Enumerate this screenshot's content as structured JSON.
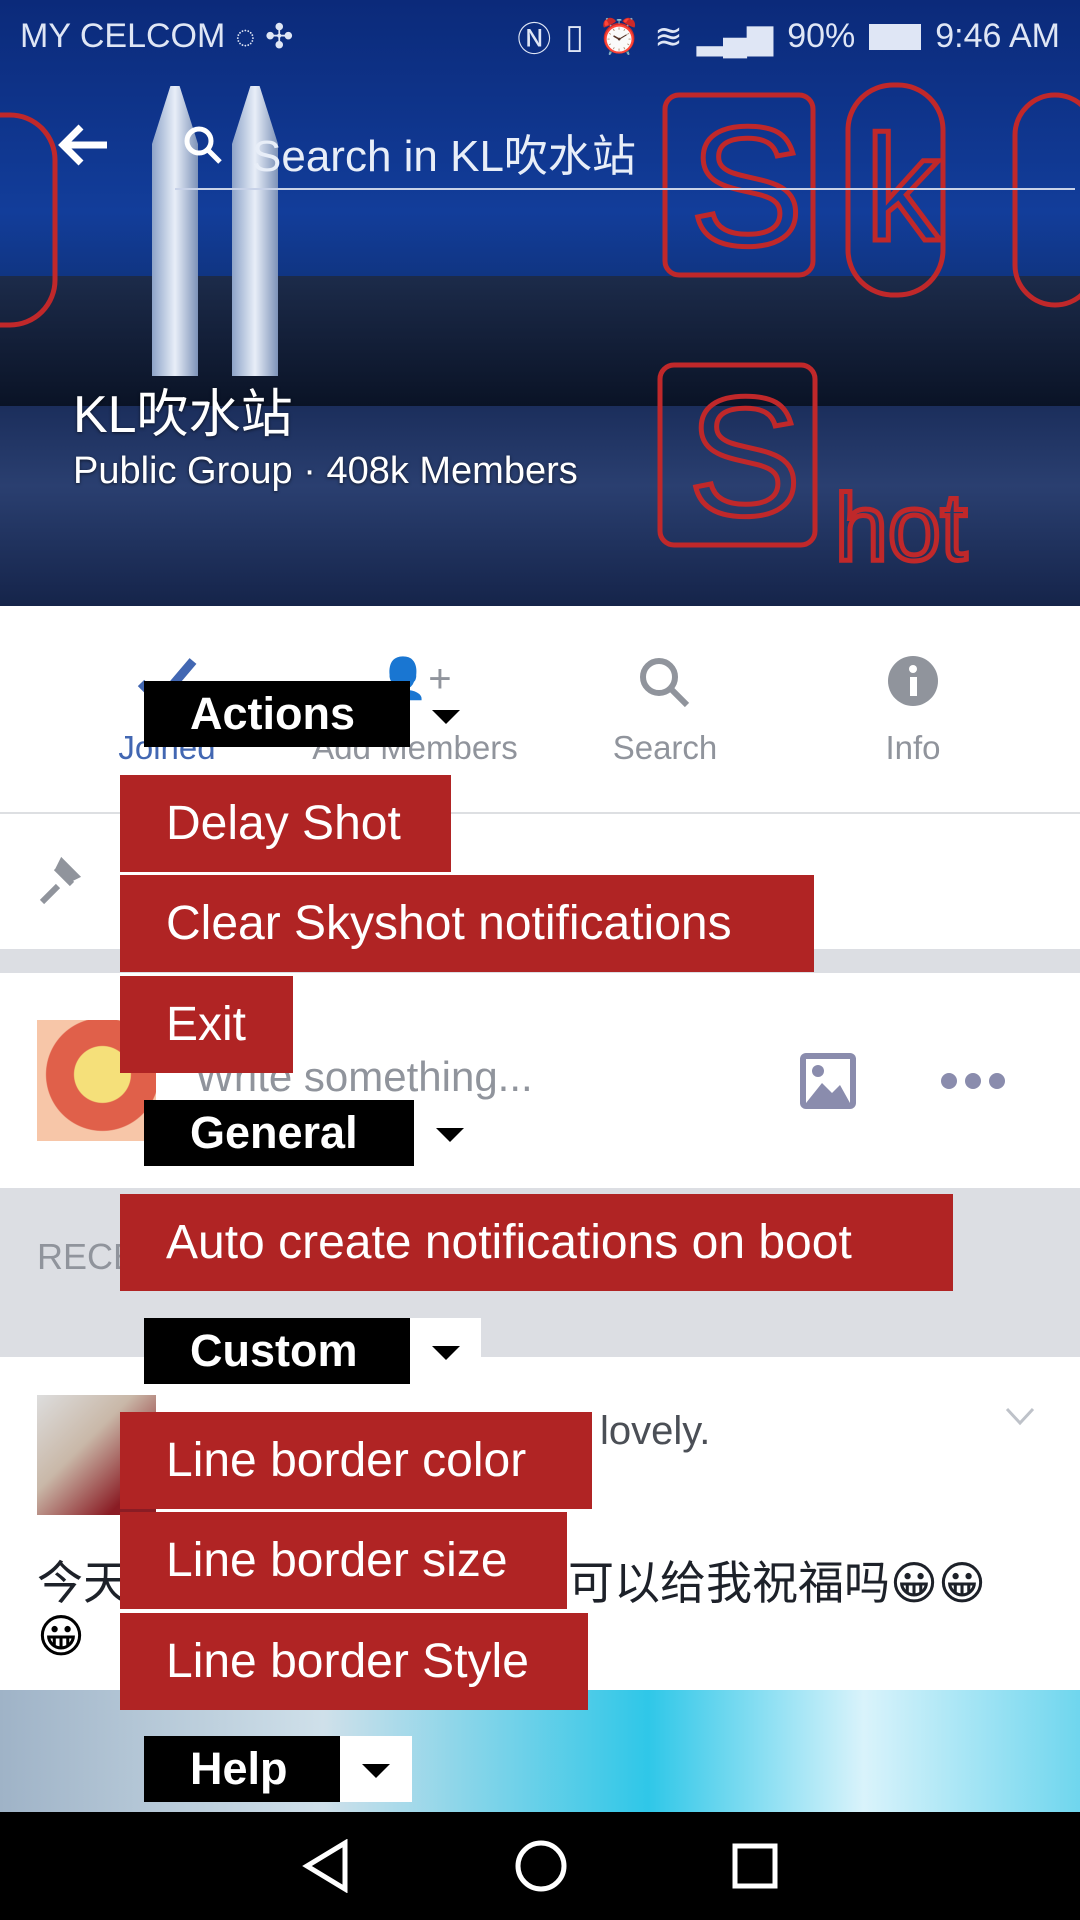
{
  "status_bar": {
    "carrier": "MY CELCOM",
    "battery": "90%",
    "time": "9:46 AM",
    "icons": [
      "whatsapp-icon",
      "pinwheel-icon",
      "nfc-icon",
      "vibrate-icon",
      "alarm-icon",
      "wifi-icon",
      "signal-icon",
      "battery-icon"
    ]
  },
  "header": {
    "search_placeholder": "Search in KL吹水站",
    "group_name": "KL吹水站",
    "group_meta": "Public Group · 408k Members"
  },
  "watermark": {
    "text": "SkyShot"
  },
  "tabs": [
    {
      "label": "Joined",
      "icon": "check-icon",
      "active": true
    },
    {
      "label": "Add Members",
      "icon": "add-person-icon"
    },
    {
      "label": "Search",
      "icon": "search-icon"
    },
    {
      "label": "Info",
      "icon": "info-icon"
    }
  ],
  "composer": {
    "placeholder": "Write something..."
  },
  "recent": {
    "label": "RECE"
  },
  "post": {
    "header_fragment": "lovely.",
    "text": "今天",
    "text_tail": "可以给我祝福吗😀😀",
    "text_line2": "😀"
  },
  "menu": {
    "actions": {
      "label": "Actions",
      "items": [
        "Delay Shot",
        "Clear Skyshot notifications",
        "Exit"
      ]
    },
    "general": {
      "label": "General",
      "items": [
        "Auto create notifications on boot"
      ]
    },
    "custom": {
      "label": "Custom",
      "items": [
        "Line border color",
        "Line border size",
        "Line border Style"
      ]
    },
    "help": {
      "label": "Help"
    }
  },
  "colors": {
    "menu_red": "#b02424",
    "facebook_blue": "#4267b2",
    "tab_grey": "#90949c"
  }
}
